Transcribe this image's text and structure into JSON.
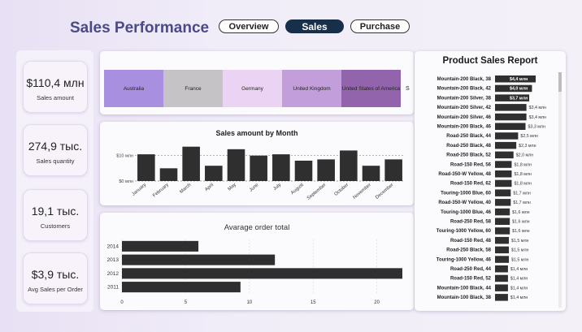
{
  "header": {
    "title": "Sales Performance",
    "tabs": [
      {
        "label": "Overview",
        "active": false
      },
      {
        "label": "Sales",
        "active": true
      },
      {
        "label": "Purchase",
        "active": false
      }
    ]
  },
  "kpis": [
    {
      "value": "$110,4 млн",
      "label": "Sales amount"
    },
    {
      "value": "274,9 тыс.",
      "label": "Sales quantity"
    },
    {
      "value": "19,1 тыс.",
      "label": "Customers"
    },
    {
      "value": "$3,9 тыс.",
      "label": "Avg Sales per Order"
    }
  ],
  "treemap": {
    "cells": [
      {
        "label": "Australia",
        "color": "#a98fe0"
      },
      {
        "label": "France",
        "color": "#c6c3c6"
      },
      {
        "label": "Germany",
        "color": "#ead3f3"
      },
      {
        "label": "United Kingdom",
        "color": "#c29fdb"
      },
      {
        "label": "United States of America",
        "color": "#9264ac"
      }
    ],
    "extra": "S"
  },
  "chart_data": [
    {
      "type": "bar",
      "title": "Sales amount by Month",
      "categories": [
        "January",
        "February",
        "March",
        "April",
        "May",
        "June",
        "July",
        "August",
        "September",
        "October",
        "November",
        "December"
      ],
      "values": [
        10.5,
        5.0,
        13.5,
        6.0,
        12.5,
        10.0,
        10.5,
        8.0,
        8.5,
        12.0,
        6.0,
        8.5
      ],
      "ytick_labels": [
        "$10 млн",
        "$0 млн"
      ],
      "ylim": [
        0,
        15
      ],
      "grid": "dashed"
    },
    {
      "type": "bar",
      "orientation": "horizontal",
      "title": "Avarage order total",
      "categories": [
        "2014",
        "2013",
        "2012",
        "2011"
      ],
      "values": [
        6,
        12,
        22,
        9.3
      ],
      "xticks": [
        "0",
        "5",
        "10",
        "15",
        "20"
      ],
      "xlim": [
        0,
        22
      ]
    },
    {
      "type": "bar",
      "orientation": "horizontal",
      "title": "Product Sales Report",
      "categories": [
        "Mountain-200 Black, 38",
        "Mountain-200 Black, 42",
        "Mountain-200 Silver, 38",
        "Mountain-200 Silver, 42",
        "Mountain-200 Silver, 46",
        "Mountain-200 Black, 46",
        "Road-250 Black, 44",
        "Road-250 Black, 48",
        "Road-250 Black, 52",
        "Road-150 Red, 56",
        "Road-350-W Yellow, 48",
        "Road-150 Red, 62",
        "Touring-1000 Blue, 60",
        "Road-350-W Yellow, 40",
        "Touring-1000 Blue, 46",
        "Road-250 Red, 58",
        "Touring-1000 Yellow, 60",
        "Road-150 Red, 48",
        "Road-250 Black, 58",
        "Touring-1000 Yellow, 46",
        "Road-250 Red, 44",
        "Road-150 Red, 52",
        "Mountain-100 Black, 44",
        "Mountain-100 Black, 38"
      ],
      "values": [
        4.4,
        4.0,
        3.7,
        3.4,
        3.4,
        3.3,
        2.5,
        2.3,
        2.0,
        1.8,
        1.8,
        1.8,
        1.7,
        1.7,
        1.6,
        1.6,
        1.6,
        1.5,
        1.5,
        1.5,
        1.4,
        1.4,
        1.4,
        1.4
      ],
      "value_labels": [
        "$4,4 млн",
        "$4,0 млн",
        "$3,7 млн",
        "$3,4 млн",
        "$3,4 млн",
        "$3,3 млн",
        "$2,5 млн",
        "$2,3 млн",
        "$2,0 млн",
        "$1,8 млн",
        "$1,8 млн",
        "$1,8 млн",
        "$1,7 млн",
        "$1,7 млн",
        "$1,6 млн",
        "$1,6 млн",
        "$1,6 млн",
        "$1,5 млн",
        "$1,5 млн",
        "$1,5 млн",
        "$1,4 млн",
        "$1,4 млн",
        "$1,4 млн",
        "$1,4 млн"
      ],
      "xlim": [
        0,
        4.4
      ]
    }
  ],
  "colors": {
    "bar": "#2f2f2f",
    "title_color": "#4a4a86",
    "active_tab": "#182f4a"
  }
}
